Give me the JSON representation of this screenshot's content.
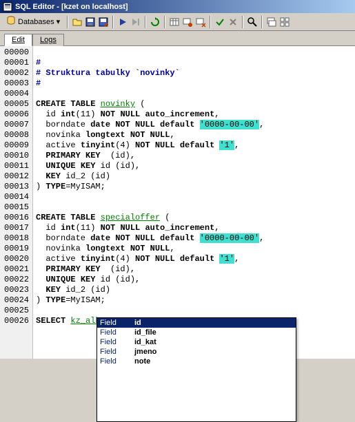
{
  "title": "SQL Editor - [kzet on localhost]",
  "toolbar": {
    "databases_label": "Databases"
  },
  "tabs": {
    "edit": "Edit",
    "logs": "Logs"
  },
  "gutter": [
    "00000",
    "00001",
    "00002",
    "00003",
    "00004",
    "00005",
    "00006",
    "00007",
    "00008",
    "00009",
    "00010",
    "00011",
    "00012",
    "00013",
    "00014",
    "00015",
    "00016",
    "00017",
    "00018",
    "00019",
    "00020",
    "00021",
    "00022",
    "00023",
    "00024",
    "00025",
    "00026"
  ],
  "code": {
    "l0": "",
    "l1": "#",
    "l2": "# Struktura tabulky `novinky`",
    "l3": "#",
    "l4": "",
    "l5a": "CREATE TABLE",
    "l5b": "novinky",
    "l5c": " (",
    "l6a": "  id ",
    "l6b": "int",
    "l6c": "(11) ",
    "l6d": "NOT NULL auto_increment",
    "l6e": ",",
    "l7a": "  borndate ",
    "l7b": "date NOT NULL default",
    "l7c": " ",
    "l7d": "'0000-00-00'",
    "l7e": ",",
    "l8a": "  novinka ",
    "l8b": "longtext NOT NULL",
    "l8c": ",",
    "l9a": "  active ",
    "l9b": "tinyint",
    "l9c": "(4) ",
    "l9d": "NOT NULL default",
    "l9e": " ",
    "l9f": "'1'",
    "l9g": ",",
    "l10a": "  ",
    "l10b": "PRIMARY KEY ",
    "l10c": " (id),",
    "l11a": "  ",
    "l11b": "UNIQUE KEY",
    "l11c": " id (id),",
    "l12a": "  ",
    "l12b": "KEY",
    "l12c": " id_2 (id)",
    "l13a": ") ",
    "l13b": "TYPE",
    "l13c": "=MyISAM;",
    "l14": "",
    "l15": "",
    "l16a": "CREATE TABLE",
    "l16b": "specialoffer",
    "l16c": " (",
    "l17a": "  id ",
    "l17b": "int",
    "l17c": "(11) ",
    "l17d": "NOT NULL auto_increment",
    "l17e": ",",
    "l18a": "  borndate ",
    "l18b": "date NOT NULL default",
    "l18c": " ",
    "l18d": "'0000-00-00'",
    "l18e": ",",
    "l19a": "  novinka ",
    "l19b": "longtext NOT NULL",
    "l19c": ",",
    "l20a": "  active ",
    "l20b": "tinyint",
    "l20c": "(4) ",
    "l20d": "NOT NULL default",
    "l20e": " ",
    "l20f": "'1'",
    "l20g": ",",
    "l21a": "  ",
    "l21b": "PRIMARY KEY ",
    "l21c": " (id),",
    "l22a": "  ",
    "l22b": "UNIQUE KEY",
    "l22c": " id (id),",
    "l23a": "  ",
    "l23b": "KEY",
    "l23c": " id_2 (id)",
    "l24a": ") ",
    "l24b": "TYPE",
    "l24c": "=MyISAM;",
    "l25": "",
    "l26a": "SELECT",
    "l26b": "kz_album",
    "l26c": "."
  },
  "autocomplete": {
    "type_label": "Field",
    "items": [
      {
        "type": "Field",
        "name": "id",
        "selected": true
      },
      {
        "type": "Field",
        "name": "id_file",
        "selected": false
      },
      {
        "type": "Field",
        "name": "id_kat",
        "selected": false
      },
      {
        "type": "Field",
        "name": "jmeno",
        "selected": false
      },
      {
        "type": "Field",
        "name": "note",
        "selected": false
      }
    ]
  }
}
